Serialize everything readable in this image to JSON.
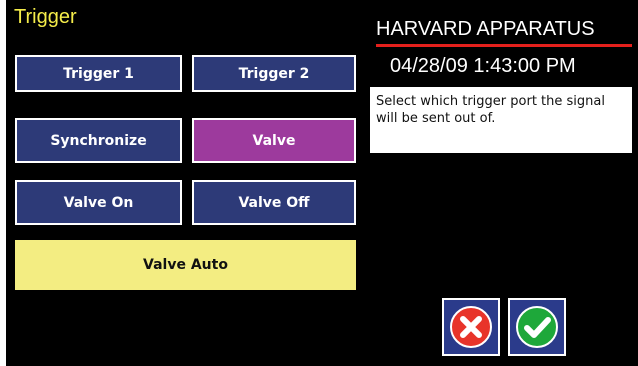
{
  "header": {
    "title": "Trigger",
    "brand": "HARVARD APPARATUS",
    "datetime": "04/28/09 1:43:00 PM"
  },
  "help": {
    "text": "Select which trigger port the signal will be sent out of."
  },
  "buttons": {
    "trigger1": "Trigger 1",
    "trigger2": "Trigger 2",
    "synchronize": "Synchronize",
    "valve": "Valve",
    "valve_on": "Valve On",
    "valve_off": "Valve Off",
    "valve_auto": "Valve Auto"
  },
  "selected": "Valve",
  "icons": {
    "cancel": "x-circle-icon",
    "confirm": "checkmark-circle-icon"
  },
  "colors": {
    "background": "#000000",
    "title": "#f4ec4a",
    "button": "#2d3a78",
    "button_selected": "#9d3a9d",
    "button_auto": "#f3ed82",
    "brand_rule": "#e4201c",
    "cancel": "#e8342a",
    "confirm": "#1ea83a"
  }
}
